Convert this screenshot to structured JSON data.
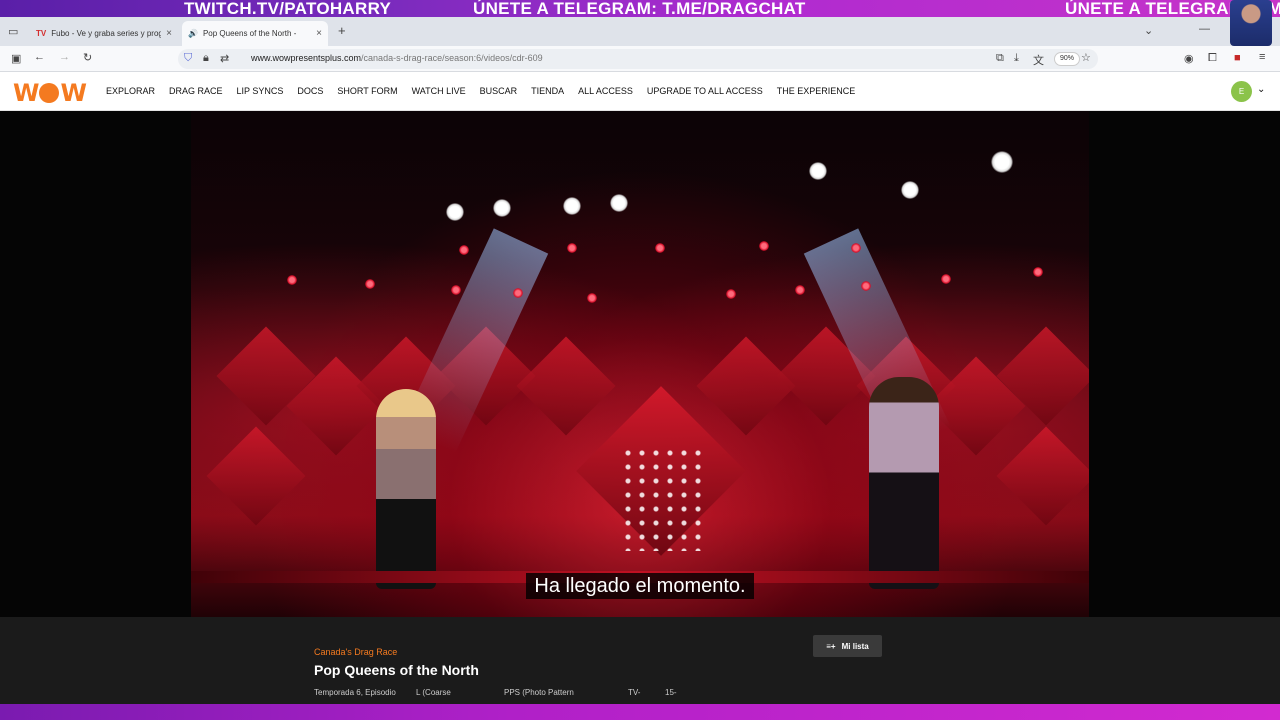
{
  "overlay": {
    "left_text": "TWITCH.TV/PATOHARRY",
    "center_text": "ÚNETE A TELEGRAM: T.ME/DRAGCHAT",
    "right_text": "ÚNETE A TELEGRAM: T.ME"
  },
  "browser": {
    "tabs": [
      {
        "icon": "TV",
        "title": "Fubo - Ve y graba series y prog",
        "close": "×"
      },
      {
        "icon": "🔊",
        "title": "Pop Queens of the North -",
        "close": "×"
      }
    ],
    "new_tab": "+",
    "url_domain": "www.wowpresentsplus.com",
    "url_path": "/canada-s-drag-race/season:6/videos/cdr-609",
    "zoom": "90%"
  },
  "site": {
    "logo_left": "W",
    "logo_right": "W",
    "nav": [
      "EXPLORAR",
      "DRAG RACE",
      "LIP SYNCS",
      "DOCS",
      "SHORT FORM",
      "WATCH LIVE",
      "BUSCAR",
      "TIENDA",
      "ALL ACCESS",
      "UPGRADE TO ALL ACCESS",
      "THE EXPERIENCE"
    ],
    "user_initial": "E"
  },
  "video": {
    "subtitle": "Ha llegado el momento."
  },
  "info": {
    "series": "Canada's Drag Race",
    "title": "Pop Queens of the North",
    "my_list": "Mi lista",
    "meta": [
      "Temporada 6, Episodio",
      "L (Coarse",
      "PPS (Photo Pattern",
      "TV-",
      "15-"
    ]
  },
  "colors": {
    "brand_orange": "#f47a20",
    "overlay_purple": "#7a2bbd"
  }
}
